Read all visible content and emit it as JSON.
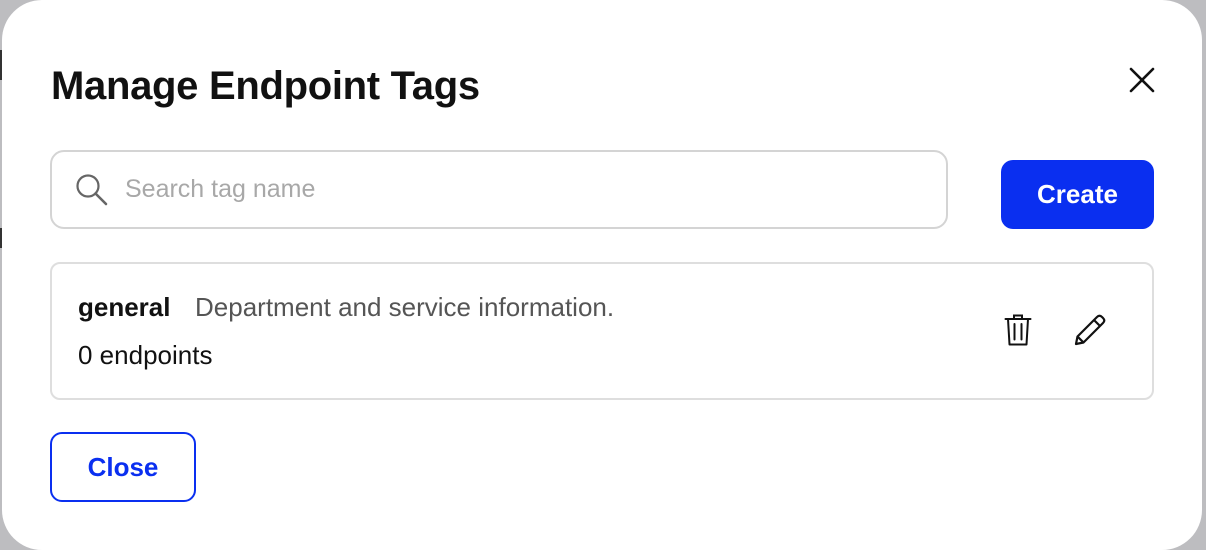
{
  "dialog": {
    "title": "Manage Endpoint Tags",
    "close_icon": "close-icon"
  },
  "search": {
    "placeholder": "Search tag name",
    "value": "",
    "icon": "search-icon"
  },
  "toolbar": {
    "create_label": "Create"
  },
  "tags": [
    {
      "name": "general",
      "description": "Department and service information.",
      "count_label": "0 endpoints",
      "actions": [
        "trash-icon",
        "pencil-icon"
      ]
    }
  ],
  "footer": {
    "close_label": "Close"
  },
  "colors": {
    "accent": "#0a2ff0",
    "border": "#d4d4d4",
    "muted_text": "#555555",
    "placeholder": "#a8a8a8"
  }
}
